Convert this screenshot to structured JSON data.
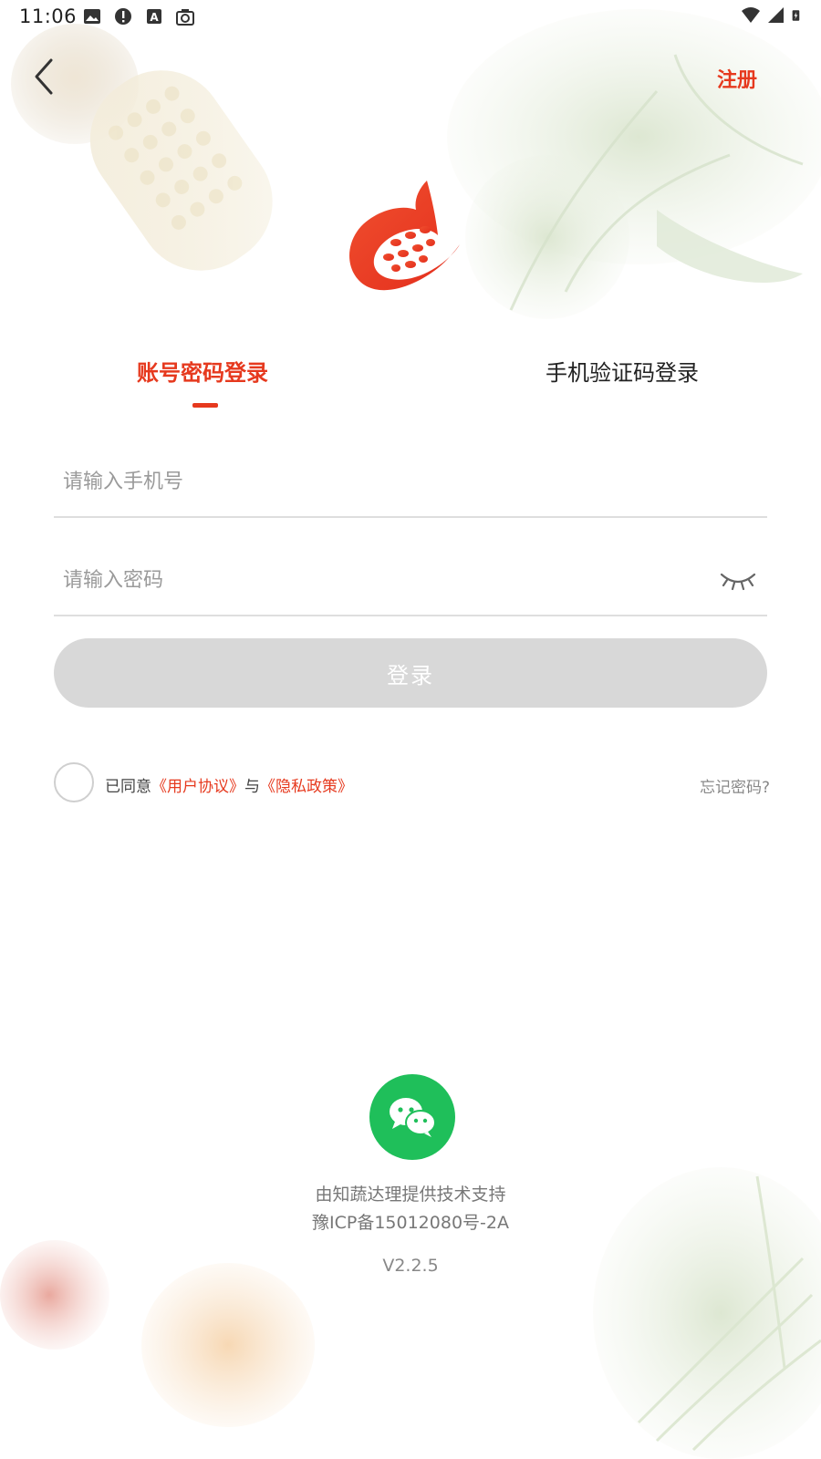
{
  "status_bar": {
    "time": "11:06",
    "left_icons": [
      "image-icon",
      "alert-icon",
      "text-a-icon",
      "camera-icon"
    ],
    "right_icons": [
      "wifi-icon",
      "signal-icon",
      "battery-charging-icon"
    ]
  },
  "header": {
    "back_icon": "chevron-left-icon",
    "register_label": "注册"
  },
  "tabs": [
    {
      "label": "账号密码登录",
      "active": true
    },
    {
      "label": "手机验证码登录",
      "active": false
    }
  ],
  "form": {
    "phone_placeholder": "请输入手机号",
    "phone_value": "",
    "password_placeholder": "请输入密码",
    "password_value": "",
    "password_toggle_icon": "eye-closed-icon",
    "login_label": "登录"
  },
  "agreement": {
    "prefix": "已同意",
    "user_agreement": "《用户协议》",
    "connector": "与",
    "privacy_policy": "《隐私政策》",
    "checked": false
  },
  "forgot_label": "忘记密码?",
  "footer": {
    "wechat_icon": "wechat-icon",
    "support": "由知蔬达理提供技术支持",
    "icp": "豫ICP备15012080号-2A",
    "version": "V2.2.5"
  },
  "colors": {
    "accent": "#e6391e",
    "wechat_green": "#1fbf5a",
    "disabled_button": "#d8d8d8"
  }
}
